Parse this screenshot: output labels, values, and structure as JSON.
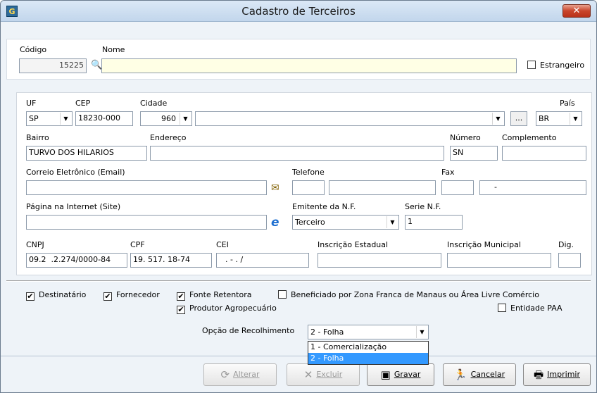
{
  "window": {
    "title": "Cadastro de Terceiros",
    "icon_label": "G",
    "close_label": "✕"
  },
  "top": {
    "codigo_label": "Código",
    "codigo_value": "15225",
    "nome_label": "Nome",
    "nome_value": "",
    "estrangeiro_label": "Estrangeiro"
  },
  "address": {
    "uf_label": "UF",
    "uf_value": "SP",
    "cep_label": "CEP",
    "cep_value": "18230-000",
    "cidade_label": "Cidade",
    "cidade_code": "960",
    "cidade_name": "",
    "ellipsis_label": "...",
    "pais_label": "País",
    "pais_value": "BR",
    "bairro_label": "Bairro",
    "bairro_value": "TURVO DOS HILARIOS",
    "endereco_label": "Endereço",
    "endereco_value": "",
    "numero_label": "Número",
    "numero_value": "SN",
    "complemento_label": "Complemento",
    "complemento_value": "",
    "email_label": "Correio Eletrônico (Email)",
    "email_value": "",
    "telefone_label": "Telefone",
    "telefone_ddd": "",
    "telefone_value": "",
    "fax_label": "Fax",
    "fax_ddd": "",
    "fax_value": "-",
    "site_label": "Página na Internet (Site)",
    "site_value": "",
    "emitente_label": "Emitente da N.F.",
    "emitente_value": "Terceiro",
    "serie_label": "Serie N.F.",
    "serie_value": "1"
  },
  "docs": {
    "cnpj_label": "CNPJ",
    "cnpj_value": "09.2  .2.274/0000-84",
    "cpf_label": "CPF",
    "cpf_value": "19. 517. 18-74",
    "cei_label": "CEI",
    "cei_value": ". - . /",
    "ie_label": "Inscrição Estadual",
    "ie_value": "",
    "im_label": "Inscrição Municipal",
    "im_value": "",
    "dig_label": "Dig.",
    "dig_value": ""
  },
  "flags": {
    "destinatario": {
      "label": "Destinatário",
      "checked": "✔"
    },
    "fornecedor": {
      "label": "Fornecedor",
      "checked": "✔"
    },
    "fonte_retentora": {
      "label": "Fonte Retentora",
      "checked": "✔"
    },
    "beneficiado": {
      "label": "Beneficiado por Zona Franca de Manaus ou Área Livre Comércio",
      "checked": ""
    },
    "produtor": {
      "label": "Produtor Agropecuário",
      "checked": "✔"
    },
    "entidade_paa": {
      "label": "Entidade PAA",
      "checked": ""
    }
  },
  "recolhimento": {
    "label": "Opção de Recolhimento",
    "value": "2 - Folha",
    "options": [
      "1 - Comercialização",
      "2 - Folha"
    ]
  },
  "buttons": {
    "alterar": "Alterar",
    "excluir": "Excluir",
    "gravar": "Gravar",
    "cancelar": "Cancelar",
    "imprimir": "Imprimir"
  },
  "colors": {
    "selection": "#3399ff",
    "input_yellow": "#ffffe5",
    "close_red": "#c9442a"
  }
}
